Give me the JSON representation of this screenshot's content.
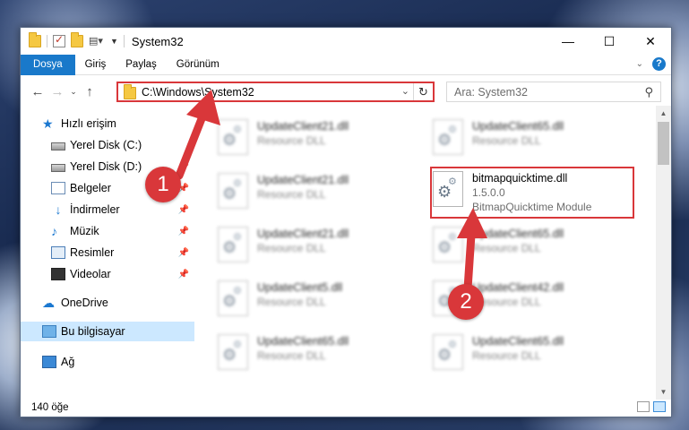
{
  "window": {
    "title": "System32",
    "controls": {
      "minimize": "—",
      "maximize": "☐",
      "close": "✕"
    }
  },
  "ribbon": {
    "tabs": [
      "Dosya",
      "Giriş",
      "Paylaş",
      "Görünüm"
    ]
  },
  "navigation": {
    "address": "C:\\Windows\\System32",
    "search_placeholder": "Ara: System32"
  },
  "sidebar": {
    "items": [
      {
        "label": "Hızlı erişim",
        "icon": "star-icon",
        "pinned": false
      },
      {
        "label": "Yerel Disk (C:)",
        "icon": "drive-icon",
        "pinned": false
      },
      {
        "label": "Yerel Disk (D:)",
        "icon": "drive-icon",
        "pinned": true
      },
      {
        "label": "Belgeler",
        "icon": "documents-icon",
        "pinned": true
      },
      {
        "label": "İndirmeler",
        "icon": "download-icon",
        "pinned": true
      },
      {
        "label": "Müzik",
        "icon": "music-icon",
        "pinned": true
      },
      {
        "label": "Resimler",
        "icon": "pictures-icon",
        "pinned": true
      },
      {
        "label": "Videolar",
        "icon": "videos-icon",
        "pinned": true
      },
      {
        "label": "OneDrive",
        "icon": "cloud-icon",
        "pinned": false
      },
      {
        "label": "Bu bilgisayar",
        "icon": "pc-icon",
        "pinned": false,
        "selected": true
      },
      {
        "label": "Ağ",
        "icon": "network-icon",
        "pinned": false
      }
    ]
  },
  "files": [
    {
      "name": "UpdateClient21.dll",
      "desc": "Resource DLL",
      "blurred": true
    },
    {
      "name": "UpdateClient65.dll",
      "desc": "Resource DLL",
      "blurred": true
    },
    {
      "name": "UpdateClient21.dll",
      "desc": "Resource DLL",
      "blurred": true
    },
    {
      "name": "bitmapquicktime.dll",
      "version": "1.5.0.0",
      "desc": "BitmapQuicktime Module",
      "blurred": false,
      "highlighted": true
    },
    {
      "name": "UpdateClient21.dll",
      "desc": "Resource DLL",
      "blurred": true
    },
    {
      "name": "UpdateClient65.dll",
      "desc": "Resource DLL",
      "blurred": true
    },
    {
      "name": "UpdateClient5.dll",
      "desc": "Resource DLL",
      "blurred": true
    },
    {
      "name": "UpdateClient42.dll",
      "desc": "Resource DLL",
      "blurred": true
    },
    {
      "name": "UpdateClient65.dll",
      "desc": "Resource DLL",
      "blurred": true
    },
    {
      "name": "UpdateClient65.dll",
      "desc": "Resource DLL",
      "blurred": true
    }
  ],
  "status": {
    "item_count": "140 öğe"
  },
  "annotations": {
    "step1": "1",
    "step2": "2",
    "color": "#d9373a"
  }
}
